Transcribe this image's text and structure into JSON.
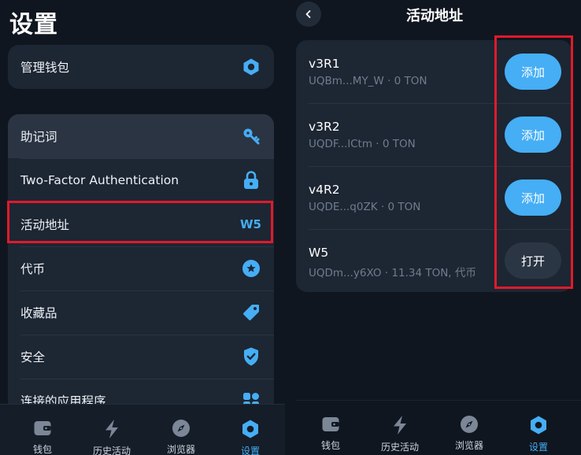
{
  "left": {
    "title": "设置",
    "wallet_card": {
      "label": "管理钱包",
      "icon": "hexagon-icon"
    },
    "items": [
      {
        "label": "助记词",
        "icon": "key-icon"
      },
      {
        "label": "Two-Factor Authentication",
        "icon": "lock-icon"
      },
      {
        "label": "活动地址",
        "value": "W5"
      },
      {
        "label": "代币",
        "icon": "star-badge-icon"
      },
      {
        "label": "收藏品",
        "icon": "tag-icon"
      },
      {
        "label": "安全",
        "icon": "shield-check-icon"
      },
      {
        "label": "连接的应用程序",
        "icon": "apps-icon"
      }
    ],
    "tabs": [
      {
        "label": "钱包",
        "icon": "wallet-icon"
      },
      {
        "label": "历史活动",
        "icon": "bolt-icon"
      },
      {
        "label": "浏览器",
        "icon": "compass-icon"
      },
      {
        "label": "设置",
        "icon": "hexagon-icon",
        "active": true
      }
    ]
  },
  "right": {
    "title": "活动地址",
    "wallets": [
      {
        "name": "v3R1",
        "address": "UQBm...MY_W · 0 TON",
        "button": "添加"
      },
      {
        "name": "v3R2",
        "address": "UQDF...lCtm · 0 TON",
        "button": "添加"
      },
      {
        "name": "v4R2",
        "address": "UQDE...q0ZK · 0 TON",
        "button": "添加"
      },
      {
        "name": "W5",
        "address": "UQDm...y6XO · 11.34 TON, 代币",
        "button": "打开"
      }
    ],
    "tabs": [
      {
        "label": "钱包",
        "icon": "wallet-icon"
      },
      {
        "label": "历史活动",
        "icon": "bolt-icon"
      },
      {
        "label": "浏览器",
        "icon": "compass-icon"
      },
      {
        "label": "设置",
        "icon": "hexagon-icon",
        "active": true
      }
    ]
  },
  "colors": {
    "accent": "#45aef5",
    "highlight": "#e01a2b",
    "card": "#1d2633",
    "background": "#10161f"
  }
}
